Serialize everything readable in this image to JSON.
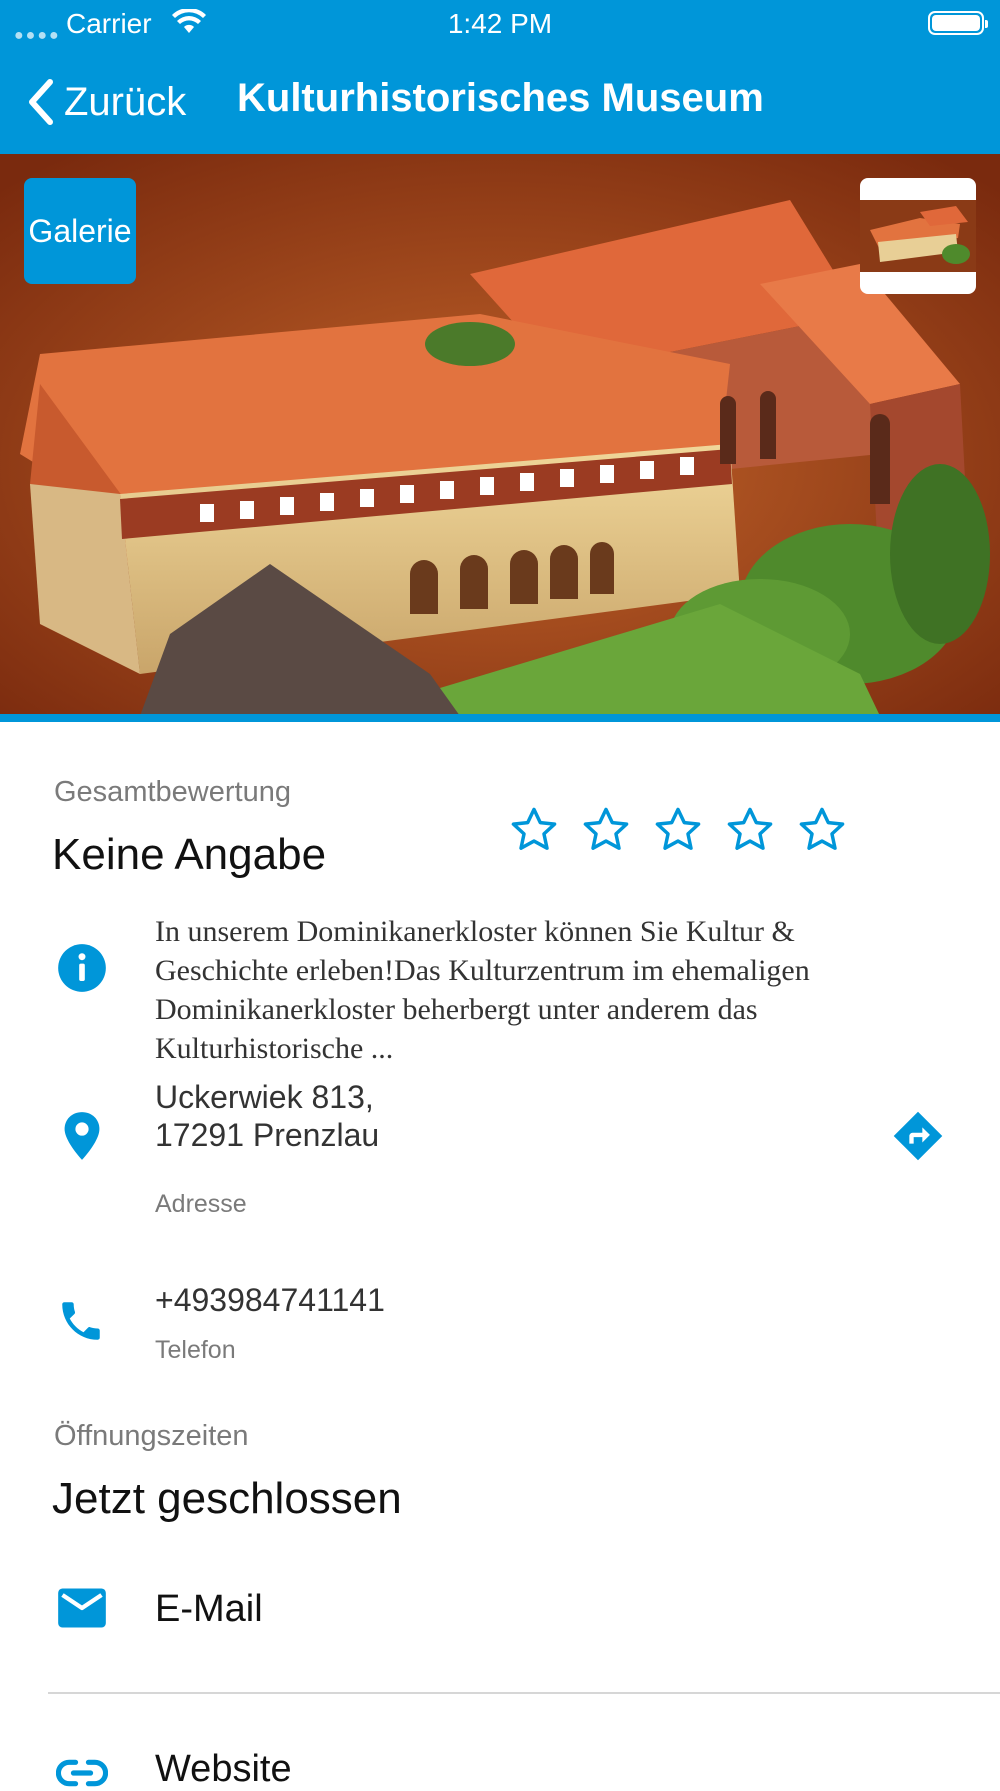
{
  "status": {
    "carrier": "Carrier",
    "time": "1:42 PM"
  },
  "nav": {
    "back_label": "Zurück",
    "title": "Kulturhistorisches Museum"
  },
  "hero": {
    "gallery_label": "Galerie"
  },
  "rating": {
    "label": "Gesamtbewertung",
    "value_text": "Keine Angabe",
    "stars_filled": 0,
    "stars_total": 5
  },
  "info": {
    "description": "In unserem Dominikanerkloster können Sie Kultur & Geschichte erleben!Das Kulturzentrum im ehemaligen Dominikanerkloster beherbergt unter anderem das Kulturhistorische ..."
  },
  "address": {
    "line1": "Uckerwiek 813,",
    "line2": "17291 Prenzlau",
    "label": "Adresse"
  },
  "phone": {
    "number": "+493984741141",
    "label": "Telefon"
  },
  "hours": {
    "label": "Öffnungszeiten",
    "status": "Jetzt geschlossen"
  },
  "links": {
    "email": "E-Mail",
    "website": "Website"
  },
  "colors": {
    "accent": "#0096d9"
  }
}
